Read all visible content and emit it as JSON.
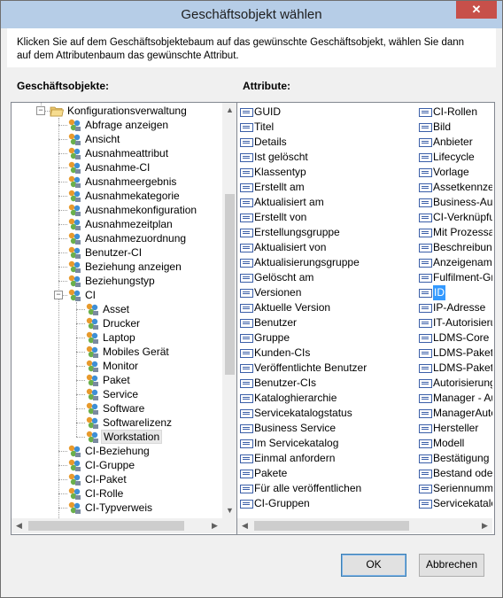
{
  "window": {
    "title": "Geschäftsobjekt wählen",
    "close_glyph": "✕"
  },
  "instructions": "Klicken Sie auf dem Geschäftsobjektebaum auf das gewünschte Geschäftsobjekt, wählen Sie dann auf dem Attributenbaum das gewünschte Attribut.",
  "tree_label": "Geschäftsobjekte:",
  "attr_label": "Attribute:",
  "tree": {
    "root": {
      "label": "Konfigurationsverwaltung",
      "expander": "−",
      "icon": "folder-open-icon"
    },
    "items": [
      "Abfrage anzeigen",
      "Ansicht",
      "Ausnahmeattribut",
      "Ausnahme-CI",
      "Ausnahmeergebnis",
      "Ausnahmekategorie",
      "Ausnahmekonfiguration",
      "Ausnahmezeitplan",
      "Ausnahmezuordnung",
      "Benutzer-CI",
      "Beziehung anzeigen",
      "Beziehungstyp"
    ],
    "ci": {
      "label": "CI",
      "expander": "−",
      "icon": "ci-object-icon"
    },
    "ci_children": [
      "Asset",
      "Drucker",
      "Laptop",
      "Mobiles Gerät",
      "Monitor",
      "Paket",
      "Service",
      "Software",
      "Softwarelizenz",
      "Workstation"
    ],
    "selected": "Workstation",
    "after_items": [
      "CI-Beziehung",
      "CI-Gruppe",
      "CI-Paket",
      "CI-Rolle",
      "CI-Typverweis"
    ]
  },
  "attributes": {
    "col1": [
      "GUID",
      "Titel",
      "Details",
      "Ist gelöscht",
      "Klassentyp",
      "Erstellt am",
      "Aktualisiert am",
      "Erstellt von",
      "Erstellungsgruppe",
      "Aktualisiert von",
      "Aktualisierungsgruppe",
      "Gelöscht am",
      "Versionen",
      "Aktuelle Version",
      "Benutzer",
      "Gruppe",
      "Kunden-CIs",
      "Veröffentlichte Benutzer",
      "Benutzer-CIs",
      "Kataloghierarchie",
      "Servicekatalogstatus",
      "Business Service",
      "Im Servicekatalog",
      "Einmal anfordern",
      "Pakete",
      "Für alle veröffentlichen",
      "CI-Gruppen"
    ],
    "col2": [
      "CI-Rollen",
      "Bild",
      "Anbieter",
      "Lifecycle",
      "Vorlage",
      "Assetkennzeichen",
      "Business-Auto",
      "CI-Verknüpfung",
      "Mit Prozessaus",
      "Beschreibung",
      "Anzeigename",
      "Fulfilment-Gru",
      "ID",
      "IP-Adresse",
      "IT-Autorisierung",
      "LDMS-Core",
      "LDMS-Paketke",
      "LDMS-Paketna",
      "Autorisierung",
      "Manager - Au",
      "ManagerAuto",
      "Hersteller",
      "Modell",
      "Bestätigung e",
      "Bestand oder",
      "Seriennumme",
      "Servicekatalo"
    ],
    "selected": "ID"
  },
  "buttons": {
    "ok": "OK",
    "cancel": "Abbrechen"
  },
  "scroll_arrows": {
    "up": "▲",
    "down": "▼",
    "left": "◀",
    "right": "▶"
  },
  "colors": {
    "title_bar": "#b6cde7",
    "close": "#c7504a",
    "selection": "#3399ff",
    "icon_blue": "#3b5fa8"
  }
}
